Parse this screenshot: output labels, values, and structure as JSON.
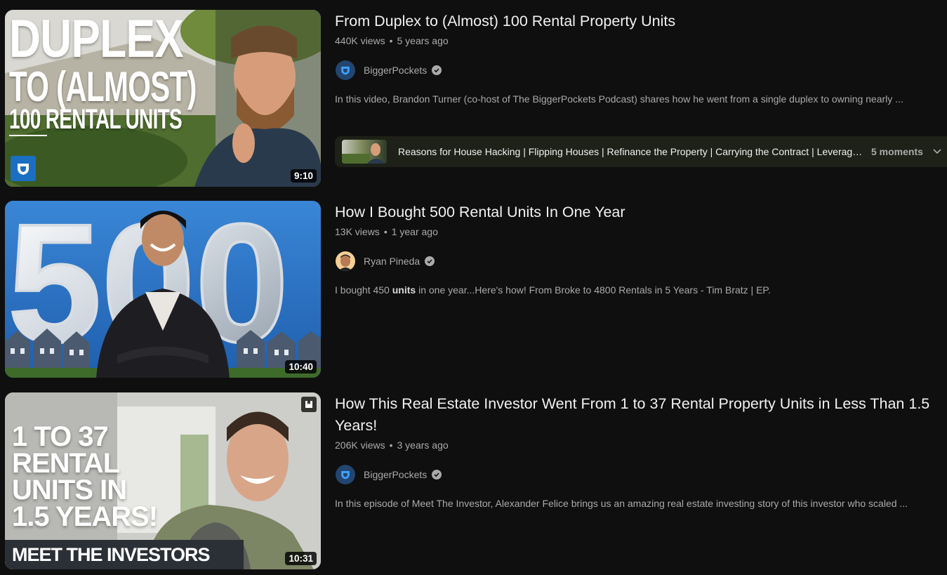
{
  "results": [
    {
      "title": "From Duplex to (Almost) 100 Rental Property Units",
      "views": "440K views",
      "age": "5 years ago",
      "channel": "BiggerPockets",
      "description": "In this video, Brandon Turner (co-host of The BiggerPockets Podcast) shares how he went from a single duplex to owning nearly ...",
      "duration": "9:10",
      "thumb_lines": [
        "DUPLEX",
        "TO (ALMOST)",
        "100 RENTAL UNITS"
      ],
      "moments": {
        "text": "Reasons for House Hacking | Flipping Houses | Refinance the Property | Carrying the Contract | Leveraging ...",
        "count": "5 moments"
      }
    },
    {
      "title": "How I Bought 500 Rental Units In One Year",
      "views": "13K views",
      "age": "1 year ago",
      "channel": "Ryan Pineda",
      "description_pre": "I bought 450 ",
      "description_bold": "units",
      "description_post": " in one year...Here's how! From Broke to 4800 Rentals in 5 Years - Tim Bratz | EP.",
      "duration": "10:40",
      "thumb_number": "500"
    },
    {
      "title": "How This Real Estate Investor Went From 1 to 37 Rental Property Units in Less Than 1.5 Years!",
      "views": "206K views",
      "age": "3 years ago",
      "channel": "BiggerPockets",
      "description": "In this episode of Meet The Investor, Alexander Felice brings us an amazing real estate investing story of this investor who scaled ...",
      "duration": "10:31",
      "thumb_lines": [
        "1 TO 37",
        "RENTAL",
        "UNITS IN",
        "1.5 YEARS!"
      ],
      "thumb_banner": "MEET THE INVESTORS"
    }
  ],
  "meta_separator": "•",
  "icons": [
    "biggerpockets-logo-icon",
    "verified-check-icon",
    "chevron-down-icon",
    "playlist-save-icon"
  ],
  "colors": {
    "background": "#0f0f0f",
    "primary_text": "#f1f1f1",
    "secondary_text": "#aaaaaa",
    "moments_bg": "#1e2117",
    "bp_blue": "#1a6fc2"
  }
}
